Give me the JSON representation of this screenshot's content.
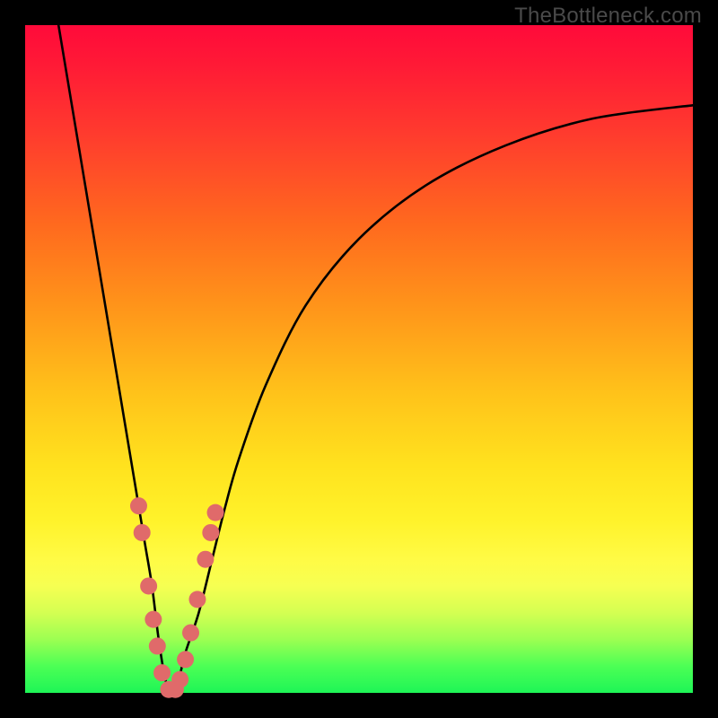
{
  "watermark": "TheBottleneck.com",
  "chart_data": {
    "type": "line",
    "title": "",
    "xlabel": "",
    "ylabel": "",
    "xlim": [
      0,
      100
    ],
    "ylim": [
      0,
      100
    ],
    "series": [
      {
        "name": "bottleneck-curve",
        "x": [
          5,
          7,
          9,
          11,
          13,
          15,
          16,
          17,
          18,
          19,
          20,
          21,
          22,
          23,
          24,
          26,
          28,
          30,
          32,
          36,
          42,
          50,
          60,
          72,
          85,
          100
        ],
        "values": [
          100,
          88,
          76,
          64,
          52,
          40,
          34,
          28,
          22,
          16,
          8,
          2,
          0,
          2,
          6,
          12,
          20,
          28,
          35,
          46,
          58,
          68,
          76,
          82,
          86,
          88
        ]
      }
    ],
    "markers": {
      "name": "curve-dots",
      "color": "#e06a6a",
      "points": [
        {
          "x": 17.0,
          "y": 28
        },
        {
          "x": 17.5,
          "y": 24
        },
        {
          "x": 18.5,
          "y": 16
        },
        {
          "x": 19.2,
          "y": 11
        },
        {
          "x": 19.8,
          "y": 7
        },
        {
          "x": 20.5,
          "y": 3
        },
        {
          "x": 21.5,
          "y": 0.5
        },
        {
          "x": 22.5,
          "y": 0.5
        },
        {
          "x": 23.2,
          "y": 2
        },
        {
          "x": 24.0,
          "y": 5
        },
        {
          "x": 24.8,
          "y": 9
        },
        {
          "x": 25.8,
          "y": 14
        },
        {
          "x": 27.0,
          "y": 20
        },
        {
          "x": 27.8,
          "y": 24
        },
        {
          "x": 28.5,
          "y": 27
        }
      ]
    }
  }
}
